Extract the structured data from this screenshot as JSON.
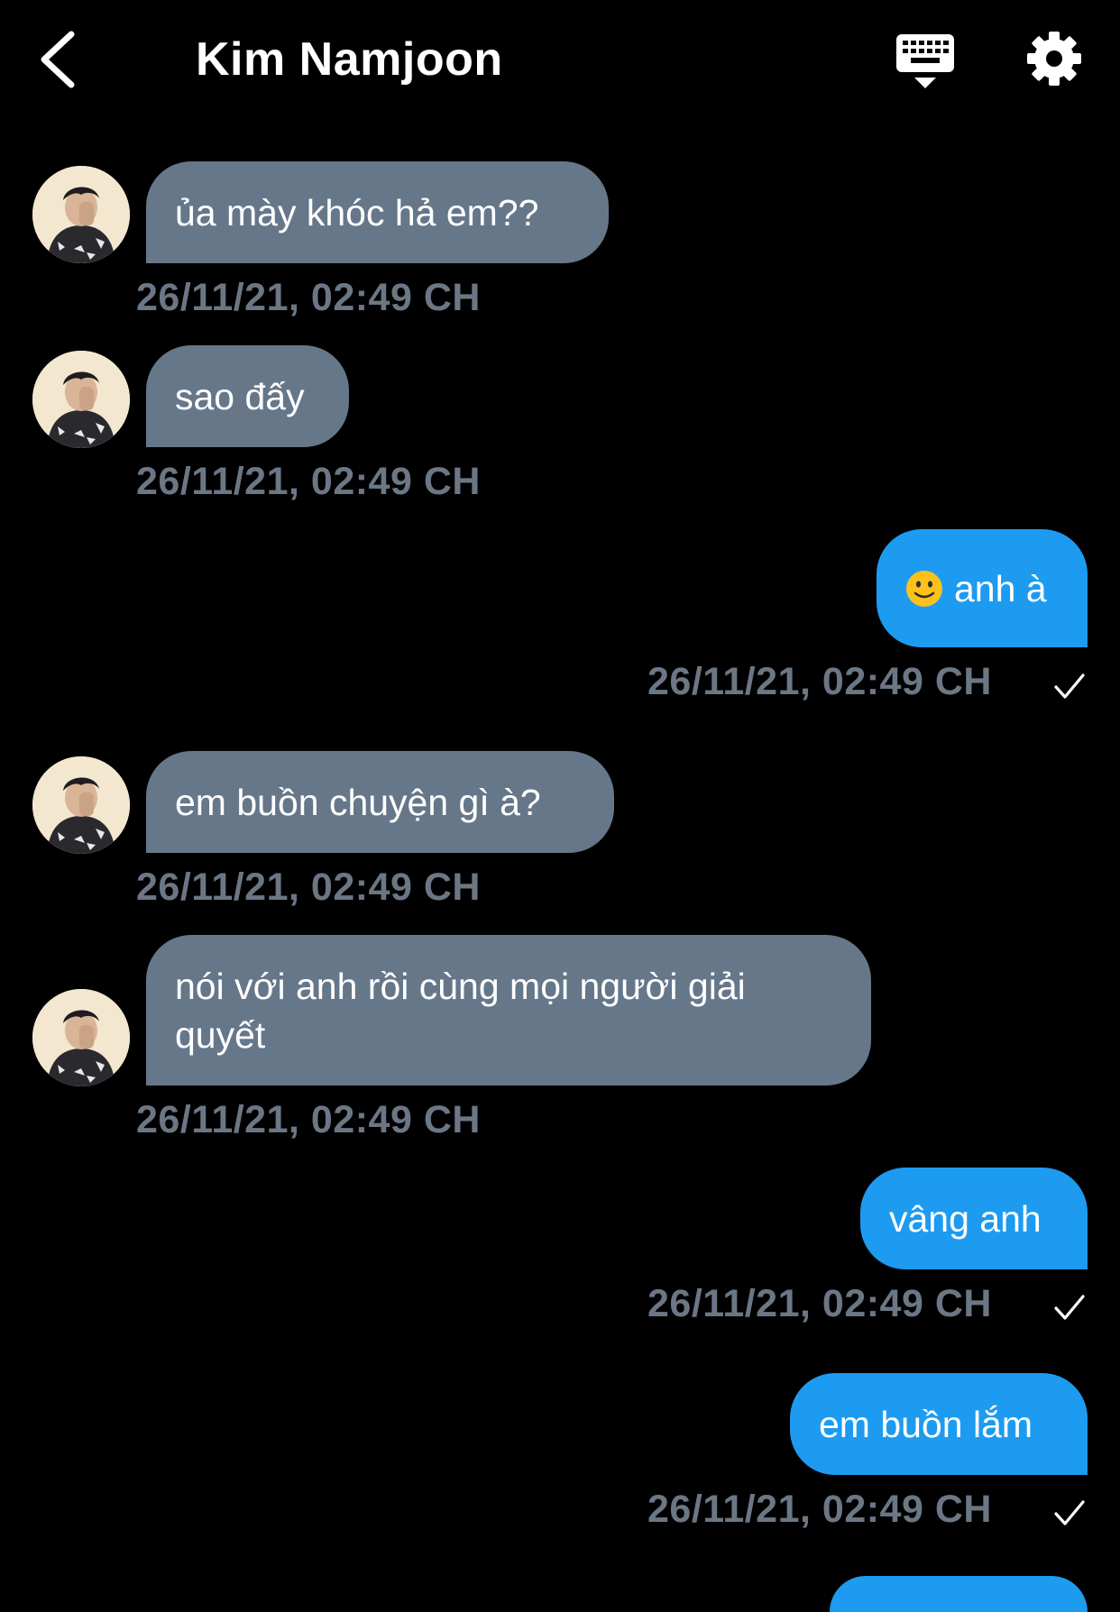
{
  "header": {
    "title": "Kim Namjoon",
    "back_icon": "chevron-left-icon",
    "keyboard_icon": "keyboard-icon",
    "settings_icon": "gear-icon"
  },
  "colors": {
    "background": "#000000",
    "incoming_bubble": "#66778a",
    "outgoing_bubble": "#1d9bf0",
    "timestamp": "#6b7785"
  },
  "messages": [
    {
      "direction": "incoming",
      "text": "ủa mày khóc hả em??",
      "time": "26/11/21, 02:49 CH"
    },
    {
      "direction": "incoming",
      "text": "sao đấy",
      "time": "26/11/21, 02:49 CH"
    },
    {
      "direction": "outgoing",
      "emoji": "slightly-smiling-face-emoji",
      "text": "anh à",
      "time": "26/11/21, 02:49 CH",
      "status_icon": "checkmark-icon"
    },
    {
      "direction": "incoming",
      "text": "em buồn chuyện gì à?",
      "time": "26/11/21, 02:49 CH"
    },
    {
      "direction": "incoming",
      "text": "nói với anh rồi cùng mọi người giải quyết",
      "time": "26/11/21, 02:49 CH"
    },
    {
      "direction": "outgoing",
      "text": "vâng anh",
      "time": "26/11/21, 02:49 CH",
      "status_icon": "checkmark-icon"
    },
    {
      "direction": "outgoing",
      "text": "em buồn lắm",
      "time": "26/11/21, 02:49 CH",
      "status_icon": "checkmark-icon"
    }
  ]
}
